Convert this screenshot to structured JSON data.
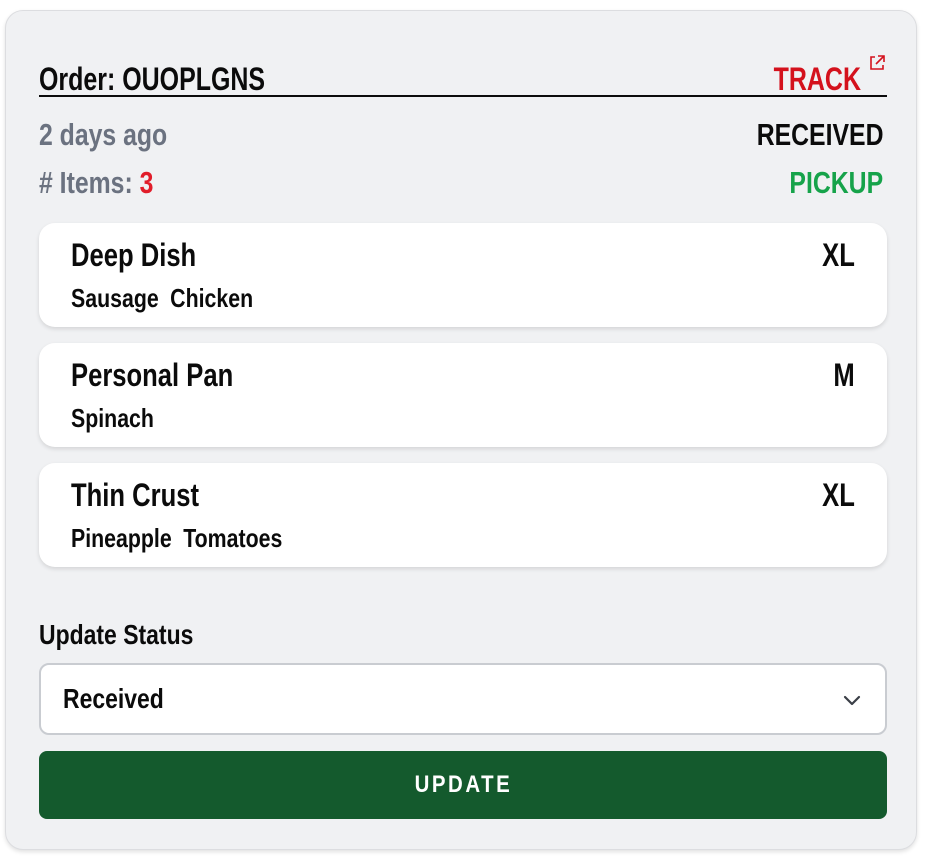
{
  "order": {
    "label": "Order: OUOPLGNS",
    "track_label": "TRACK",
    "time_ago": "2 days ago",
    "status": "RECEIVED",
    "items_label": "# Items:",
    "items_count": "3",
    "method": "PICKUP"
  },
  "items": [
    {
      "name": "Deep Dish",
      "size": "XL",
      "toppings": [
        "Sausage",
        "Chicken"
      ]
    },
    {
      "name": "Personal Pan",
      "size": "M",
      "toppings": [
        "Spinach"
      ]
    },
    {
      "name": "Thin Crust",
      "size": "XL",
      "toppings": [
        "Pineapple",
        "Tomatoes"
      ]
    }
  ],
  "update_status": {
    "label": "Update Status",
    "selected": "Received",
    "button_label": "UPDATE"
  },
  "colors": {
    "accent_red": "#d4111c",
    "pickup_green": "#16a34a",
    "button_green": "#145a2d",
    "card_bg": "#f0f1f3"
  },
  "icons": {
    "track": "external-link-icon",
    "select": "chevron-down-icon"
  }
}
